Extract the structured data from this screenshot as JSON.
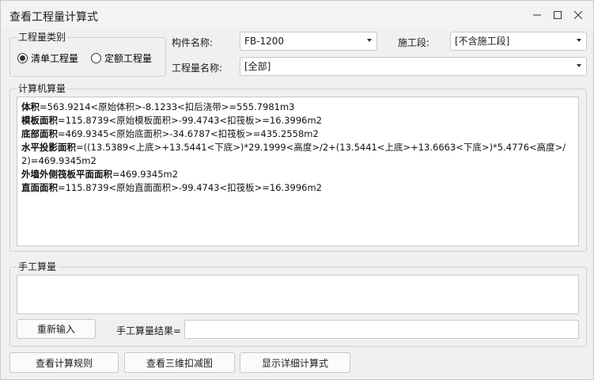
{
  "window": {
    "title": "查看工程量计算式"
  },
  "quantity_type": {
    "group_label": "工程量类别",
    "options": [
      {
        "label": "清单工程量",
        "selected": true
      },
      {
        "label": "定额工程量",
        "selected": false
      }
    ]
  },
  "fields": {
    "component_label": "构件名称:",
    "component_value": "FB-1200",
    "stage_label": "施工段:",
    "stage_value": "[不含施工段]",
    "quantity_name_label": "工程量名称:",
    "quantity_name_value": "[全部]"
  },
  "computer_calc": {
    "group_label": "计算机算量",
    "lines": [
      {
        "name": "体积",
        "expr": "=563.9214<原始体积>-8.1233<扣后浇带>=555.7981m3"
      },
      {
        "name": "模板面积",
        "expr": "=115.8739<原始模板面积>-99.4743<扣筏板>=16.3996m2"
      },
      {
        "name": "底部面积",
        "expr": "=469.9345<原始底面积>-34.6787<扣筏板>=435.2558m2"
      },
      {
        "name": "水平投影面积",
        "expr": "=((13.5389<上底>+13.5441<下底>)*29.1999<高度>/2+(13.5441<上底>+13.6663<下底>)*5.4776<高度>/2)=469.9345m2"
      },
      {
        "name": "外墙外侧筏板平面面积",
        "expr": "=469.9345m2"
      },
      {
        "name": "直面面积",
        "expr": "=115.8739<原始直面面积>-99.4743<扣筏板>=16.3996m2"
      }
    ]
  },
  "manual_calc": {
    "group_label": "手工算量",
    "reenter_button": "重新输入",
    "result_label": "手工算量结果=",
    "result_value": ""
  },
  "footer": {
    "view_rules_button": "查看计算规则",
    "view_3d_button": "查看三维扣减图",
    "show_detail_button": "显示详细计算式"
  },
  "icons": {
    "minimize": "minimize-icon",
    "maximize": "maximize-icon",
    "close": "close-icon"
  }
}
